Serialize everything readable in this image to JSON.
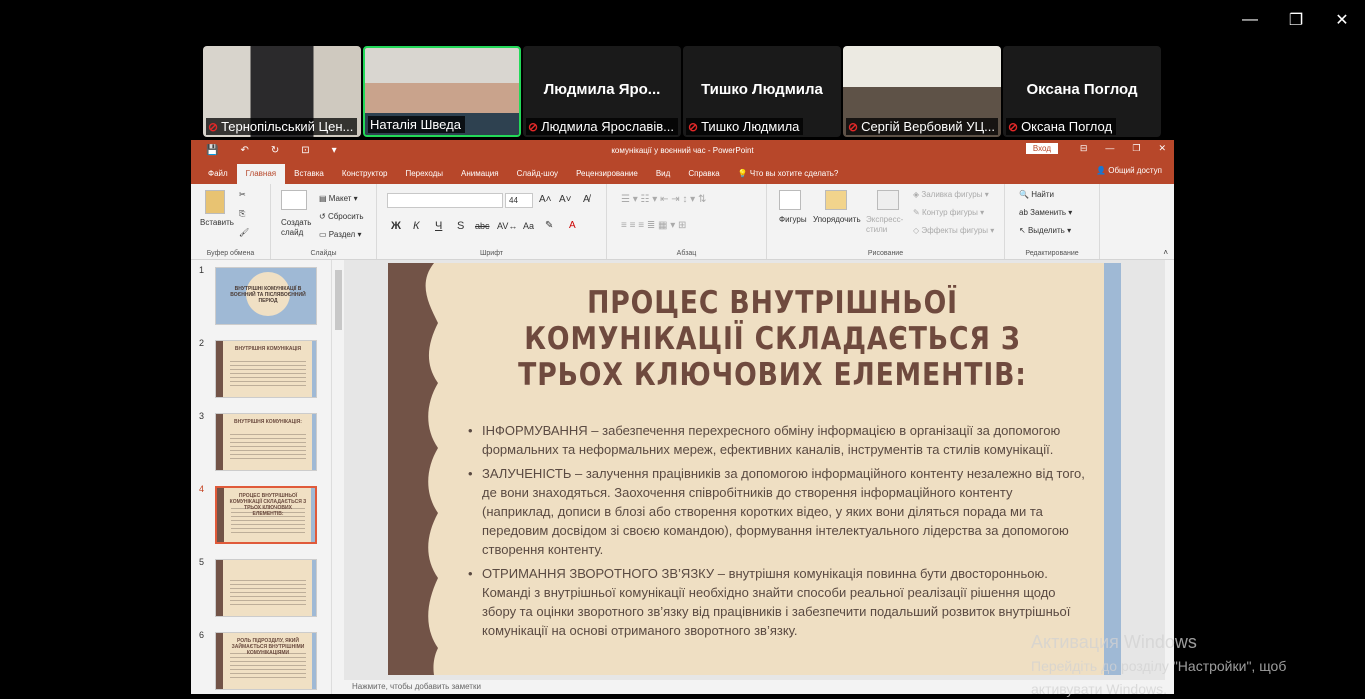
{
  "window_controls": {
    "minimize": "—",
    "restore": "❐",
    "close": "✕"
  },
  "participants": [
    {
      "name": "Тернопільський Цен...",
      "video": true,
      "muted": true,
      "active": false,
      "big_name": ""
    },
    {
      "name": "Наталія Шведа",
      "video": true,
      "muted": false,
      "active": true,
      "big_name": ""
    },
    {
      "name": "Людмила Ярославів...",
      "video": false,
      "muted": true,
      "active": false,
      "big_name": "Людмила  Яро..."
    },
    {
      "name": "Тишко Людмила",
      "video": false,
      "muted": true,
      "active": false,
      "big_name": "Тишко Людмила"
    },
    {
      "name": "Сергій Вербовий УЦ...",
      "video": true,
      "muted": true,
      "active": false,
      "big_name": ""
    },
    {
      "name": "Оксана Поглод",
      "video": false,
      "muted": true,
      "active": false,
      "big_name": "Оксана Поглод"
    }
  ],
  "ppt": {
    "title": "комунікації у воєнний час  -  PowerPoint",
    "login_label": "Вход",
    "tabs": [
      "Файл",
      "Главная",
      "Вставка",
      "Конструктор",
      "Переходы",
      "Анимация",
      "Слайд-шоу",
      "Рецензирование",
      "Вид",
      "Справка"
    ],
    "selected_tab": "Главная",
    "tell_me": "Что вы хотите сделать?",
    "share": "Общий доступ",
    "ribbon": {
      "clipboard": {
        "paste": "Вставить",
        "group": "Буфер обмена"
      },
      "slides": {
        "new_slide": "Создать слайд",
        "layout": "Макет",
        "reset": "Сбросить",
        "section": "Раздел",
        "group": "Слайды"
      },
      "font": {
        "size": "44",
        "group": "Шрифт",
        "b": "Ж",
        "i": "К",
        "u": "Ч",
        "s": "S",
        "abc": "abc",
        "aa": "Aa"
      },
      "paragraph": {
        "group": "Абзац"
      },
      "drawing": {
        "shapes": "Фигуры",
        "arrange": "Упорядочить",
        "quick_styles": "Экспресс-стили",
        "fill": "Заливка фигуры",
        "outline": "Контур фигуры",
        "effects": "Эффекты фигуры",
        "group": "Рисование"
      },
      "editing": {
        "find": "Найти",
        "replace": "Заменить",
        "select": "Выделить",
        "group": "Редактирование"
      }
    },
    "thumbnails": [
      {
        "num": "1",
        "title": "ВНУТРІШНІ КОМУНІКАЦІЇ В ВОЄННИЙ ТА ПІСЛЯВОЄННИЙ ПЕРІОД",
        "cover": true
      },
      {
        "num": "2",
        "title": "ВНУТРІШНЯ КОМУНІКАЦІЯ",
        "cover": false
      },
      {
        "num": "3",
        "title": "ВНУТРІШНЯ КОМУНІКАЦІЯ:",
        "cover": false
      },
      {
        "num": "4",
        "title": "ПРОЦЕС ВНУТРІШНЬОЇ КОМУНІКАЦІЇ СКЛАДАЄТЬСЯ З ТРЬОХ КЛЮЧОВИХ ЕЛЕМЕНТІВ:",
        "cover": false,
        "selected": true
      },
      {
        "num": "5",
        "title": "",
        "cover": false
      },
      {
        "num": "6",
        "title": "РОЛЬ ПІДРОЗДІЛУ, ЯКИЙ ЗАЙМАЄТЬСЯ ВНУТРІШНІМИ КОМУНІКАЦІЯМИ",
        "cover": false
      }
    ],
    "slide": {
      "heading": "ПРОЦЕС ВНУТРІШНЬОЇ КОМУНІКАЦІЇ СКЛАДАЄТЬСЯ З ТРЬОХ КЛЮЧОВИХ ЕЛЕМЕНТІВ:",
      "bullets": [
        "ІНФОРМУВАННЯ – забезпечення перехресного обміну інформацією в організації за допомогою формальних та неформальних мереж, ефективних каналів, інструментів та стилів комунікації.",
        "ЗАЛУЧЕНІСТЬ –  залучення працівників за допомогою інформаційного контенту незалежно від того, де вони знаходяться. Заохочення співробітників до створення інформаційного контенту (наприклад, дописи в блозі або створення коротких відео, у яких вони діляться порада ми та передовим досвідом зі своєю командою), формування інтелектуального лідерства за допомогою створення контенту.",
        "ОТРИМАННЯ ЗВОРОТНОГО ЗВ’ЯЗКУ – внутрішня комунікація повинна бути двосторонньою. Команді з внутрішньої комунікації необхідно знайти способи реальної реалізації рішення щодо збору та оцінки зворотного зв’язку від працівників і забезпечити подальший розвиток внутрішньої комунікації на основі отриманого зворотного зв’язку."
      ],
      "colors": {
        "bg": "#efdfc3",
        "brown": "#725347",
        "blue": "#9fb9d5",
        "heading": "#6f4a3e"
      }
    },
    "notes_placeholder": "Нажмите, чтобы добавить заметки"
  },
  "activation": {
    "line1": "Активация Windows",
    "line2": "Перейдіть до розділу \"Настройки\", щоб",
    "line3": "активувати Windows."
  }
}
